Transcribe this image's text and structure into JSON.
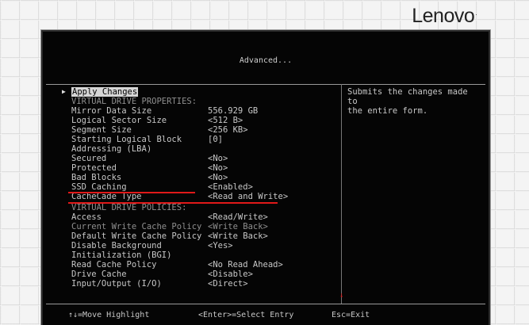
{
  "brand": {
    "name": "Lenovo",
    "mark": "."
  },
  "screen": {
    "title": "Advanced..."
  },
  "apply_changes": "Apply Changes",
  "help_text": "Submits the changes made to\nthe entire form.",
  "properties_header": "VIRTUAL DRIVE PROPERTIES:",
  "properties": [
    {
      "label": "Mirror Data Size",
      "value": "556.929 GB"
    },
    {
      "label": "Logical Sector Size",
      "value": "<512 B>"
    },
    {
      "label": "Segment Size",
      "value": "<256 KB>"
    },
    {
      "label": "Starting Logical Block",
      "value": "[0]"
    },
    {
      "label": "Addressing (LBA)",
      "value": ""
    },
    {
      "label": "Secured",
      "value": "<No>"
    },
    {
      "label": "Protected",
      "value": "<No>"
    },
    {
      "label": "Bad Blocks",
      "value": "<No>"
    },
    {
      "label": "SSD Caching",
      "value": "<Enabled>"
    },
    {
      "label": "CacheCade Type",
      "value": "<Read and Write>"
    }
  ],
  "policies_header": "VIRTUAL DRIVE POLICIES:",
  "policies": [
    {
      "label": "Access",
      "value": "<Read/Write>"
    },
    {
      "label": "Current Write Cache Policy",
      "value": "<Write Back>"
    },
    {
      "label": "Default Write Cache Policy",
      "value": "<Write Back>"
    },
    {
      "label": "Disable Background",
      "value": "<Yes>"
    },
    {
      "label": "Initialization (BGI)",
      "value": ""
    },
    {
      "label": "Read Cache Policy",
      "value": "<No Read Ahead>"
    },
    {
      "label": "Drive Cache",
      "value": "<Disable>"
    },
    {
      "label": "Input/Output (I/O)",
      "value": "<Direct>"
    }
  ],
  "footer": {
    "nav": "↑↓=Move Highlight",
    "enter": "<Enter>=Select Entry",
    "esc": "Esc=Exit"
  },
  "colors": {
    "screen_bg": "#050505",
    "text": "#c8c8c8",
    "annotation": "#e01919",
    "highlight": "#d6d6d6"
  }
}
